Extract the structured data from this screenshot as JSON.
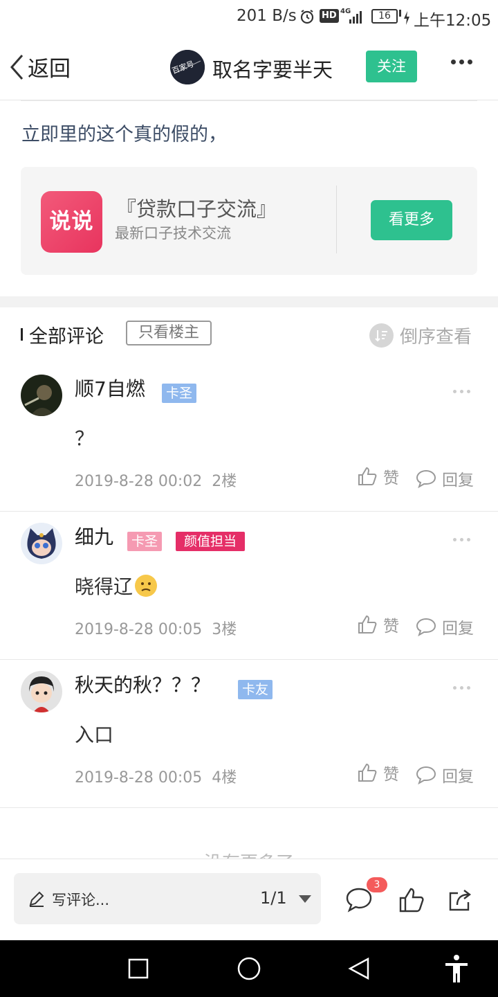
{
  "status": {
    "speed": "201 B/s",
    "battery": "16",
    "time": "上午12:05",
    "network": "4G",
    "hd": "HD"
  },
  "header": {
    "back_label": "返回",
    "title": "取名字要半天",
    "follow_label": "关注",
    "avatar_text": "百家号"
  },
  "post": {
    "text": "立即里的这个真的假的，"
  },
  "card": {
    "logo_text": "说说",
    "title": "『贷款口子交流』",
    "subtitle": "最新口子技术交流",
    "button": "看更多"
  },
  "comments_header": {
    "title": "全部评论",
    "only_op": "只看楼主",
    "reverse": "倒序查看"
  },
  "comments": [
    {
      "name": "顺7自燃",
      "badges": [
        {
          "text": "卡圣",
          "color": "#8fb8ee"
        }
      ],
      "body": "？",
      "time": "2019-8-28 00:02",
      "floor": "2楼",
      "like": "赞",
      "reply": "回复"
    },
    {
      "name": "细九",
      "badges": [
        {
          "text": "卡圣",
          "color": "#f59ab2"
        },
        {
          "text": "颜值担当",
          "color": "#e52e67"
        }
      ],
      "body": "晓得辽",
      "time": "2019-8-28 00:05",
      "floor": "3楼",
      "like": "赞",
      "reply": "回复"
    },
    {
      "name": "秋天的秋？？？",
      "badges": [
        {
          "text": "卡友",
          "color": "#8fb8ee"
        }
      ],
      "body": "入口",
      "time": "2019-8-28 00:05",
      "floor": "4楼",
      "like": "赞",
      "reply": "回复"
    }
  ],
  "footer": {
    "no_more": "没有更多了",
    "placeholder": "写评论...",
    "pager": "1/1",
    "comment_count": "3"
  }
}
